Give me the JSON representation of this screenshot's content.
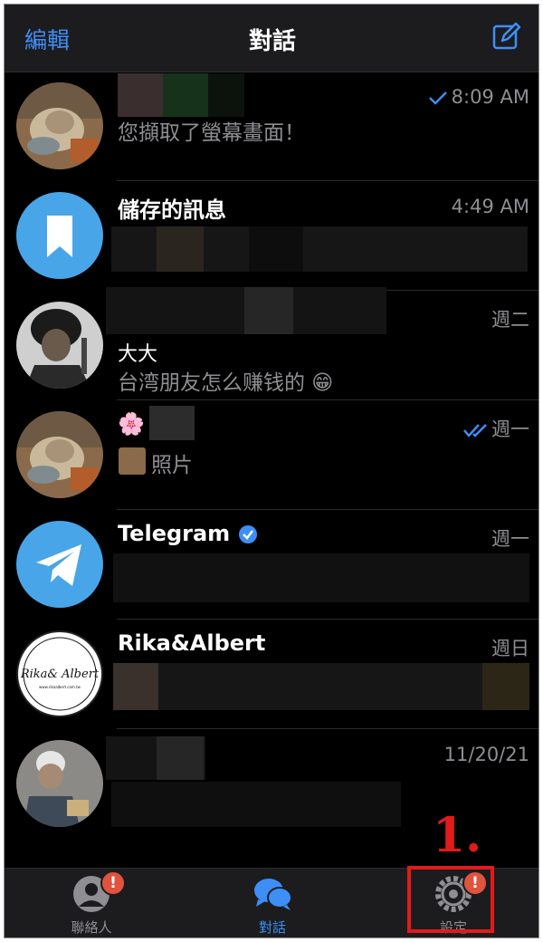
{
  "header": {
    "edit_label": "編輯",
    "title": "對話",
    "compose_icon": "compose-icon"
  },
  "chats": [
    {
      "name": "",
      "time": "8:09 AM",
      "read_status": "sent-single-check",
      "preview": "您擷取了螢幕畫面！",
      "avatar": "cat-photo"
    },
    {
      "name": "儲存的訊息",
      "time": "4:49 AM",
      "preview": "",
      "avatar": "bookmark-icon"
    },
    {
      "name": "",
      "time": "週二",
      "sender": "大大",
      "preview": "台湾朋友怎么赚钱的 😁",
      "avatar": "person-photo"
    },
    {
      "name": "🌸",
      "time": "週一",
      "read_status": "read-double-check",
      "preview": "照片",
      "avatar": "cat-photo"
    },
    {
      "name": "Telegram",
      "time": "週一",
      "verified": true,
      "preview": "",
      "avatar": "telegram-icon"
    },
    {
      "name": "Rika&Albert",
      "time": "週日",
      "preview": "",
      "avatar": "rika-albert-logo",
      "logo_text": "Rika& Albert",
      "logo_sub": "www.rikaalbert.com.tw"
    },
    {
      "name": "",
      "time": "11/20/21",
      "preview": "",
      "avatar": "person-photo"
    }
  ],
  "tabbar": {
    "tabs": [
      {
        "label": "聯絡人",
        "icon": "contacts-icon",
        "badge": "!"
      },
      {
        "label": "對話",
        "icon": "chats-icon",
        "active": true
      },
      {
        "label": "設定",
        "icon": "settings-gear-icon",
        "badge": "!"
      }
    ]
  },
  "annotation": {
    "label": "1.",
    "color": "#e21a1a"
  },
  "colors": {
    "accent": "#3e8ef7",
    "badge": "#e0533f",
    "background": "#000000"
  }
}
